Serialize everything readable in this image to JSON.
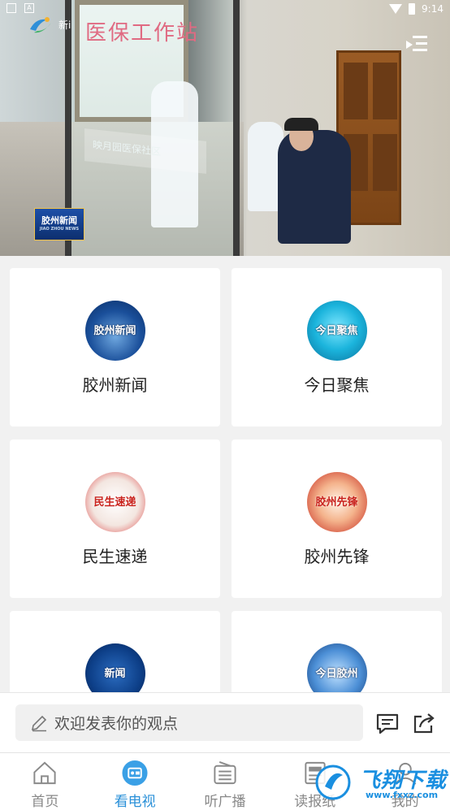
{
  "video": {
    "scene_title": "医保工作站",
    "sign_text": "映月园医保社区",
    "channel_logo": "胶州新闻",
    "channel_logo_sub": "JIAO ZHOU NEWS"
  },
  "statusbar": {
    "time": "9:14",
    "app_name": "新i"
  },
  "grid": {
    "items": [
      {
        "label": "胶州新闻",
        "icon_text": "胶州新闻",
        "icon": "jiaozhou-news-icon"
      },
      {
        "label": "今日聚焦",
        "icon_text": "今日聚焦",
        "icon": "today-focus-icon"
      },
      {
        "label": "民生速递",
        "icon_text": "民生速递",
        "icon": "livelihood-express-icon"
      },
      {
        "label": "胶州先锋",
        "icon_text": "胶州先锋",
        "icon": "jiaozhou-pioneer-icon"
      },
      {
        "label": "",
        "icon_text": "新闻",
        "icon": "news-channel-icon"
      },
      {
        "label": "",
        "icon_text": "今日胶州",
        "icon": "today-jiaozhou-icon"
      }
    ]
  },
  "comment": {
    "placeholder": "欢迎发表你的观点"
  },
  "nav": {
    "items": [
      {
        "label": "首页",
        "icon": "home-icon"
      },
      {
        "label": "看电视",
        "icon": "tv-icon"
      },
      {
        "label": "听广播",
        "icon": "radio-icon"
      },
      {
        "label": "读报纸",
        "icon": "newspaper-icon"
      },
      {
        "label": "我的",
        "icon": "profile-icon"
      }
    ],
    "active_index": 1
  },
  "watermark": {
    "text": "飞翔下载",
    "url": "www.fxxz.com"
  },
  "colors": {
    "accent": "#2a90d8",
    "card_bg": "#ffffff",
    "page_bg": "#f1f1f1"
  }
}
